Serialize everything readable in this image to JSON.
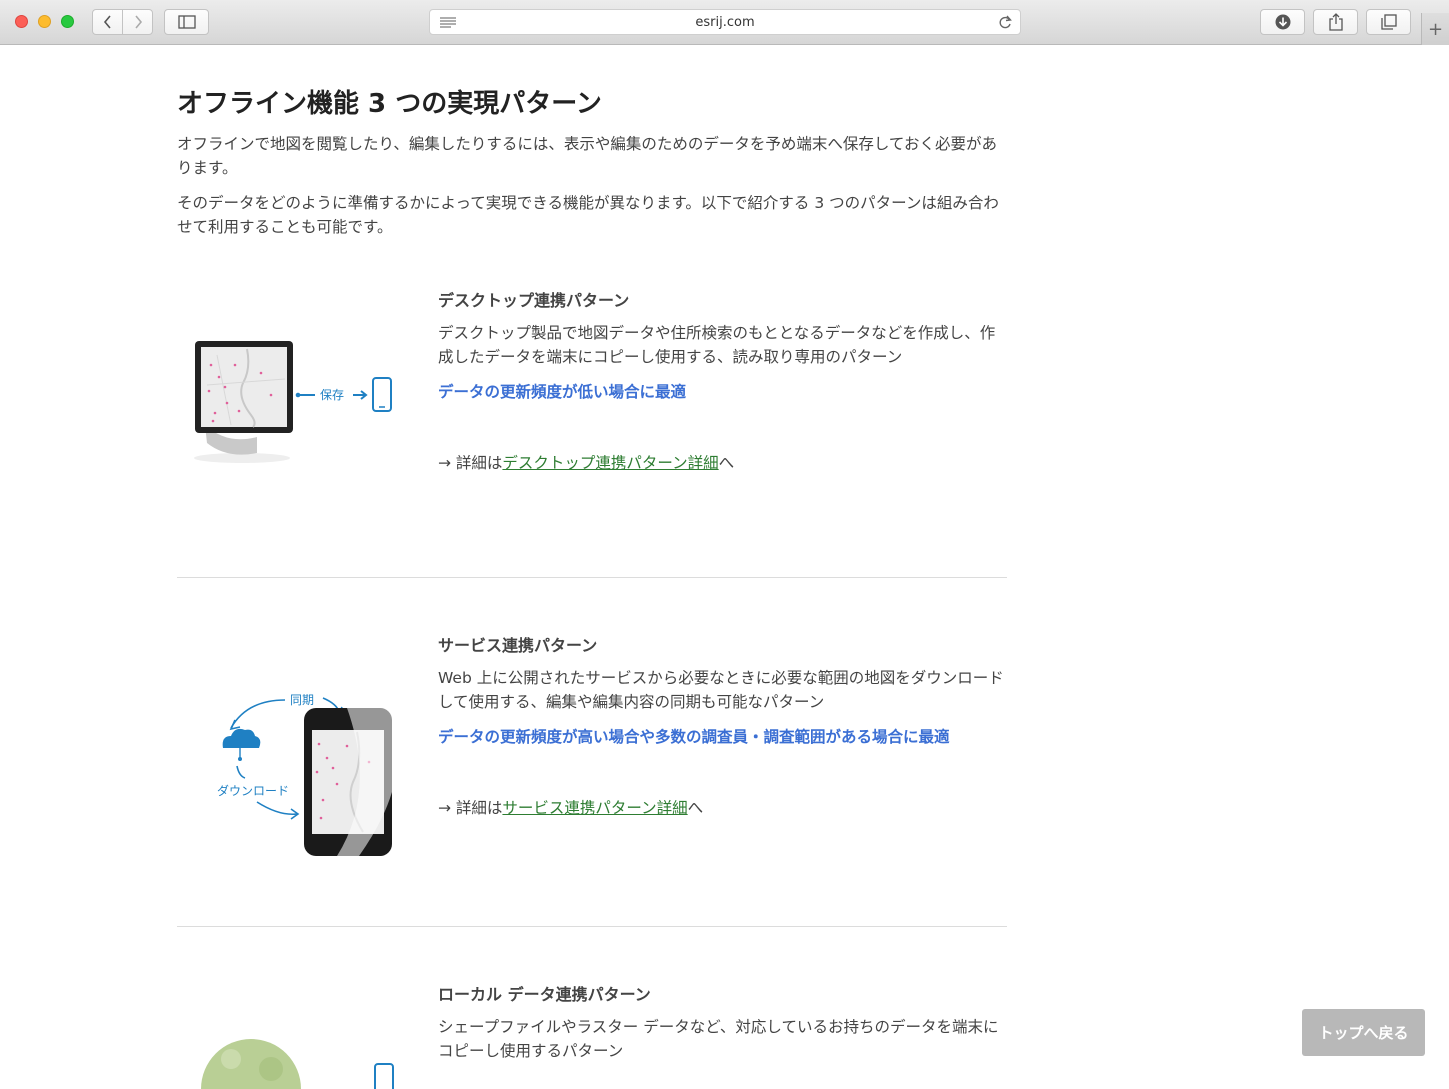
{
  "browser": {
    "url": "esrij.com",
    "new_tab_glyph": "+"
  },
  "page": {
    "title": "オフライン機能 3 つの実現パターン",
    "intro": [
      "オフラインで地図を閲覧したり、編集したりするには、表示や編集のためのデータを予め端末へ保存しておく必要があります。",
      "そのデータをどのように準備するかによって実現できる機能が異なります。以下で紹介する 3 つのパターンは組み合わせて利用することも可能です。"
    ],
    "sections": [
      {
        "title": "デスクトップ連携パターン",
        "desc": "デスクトップ製品で地図データや住所検索のもととなるデータなどを作成し、作成したデータを端末にコピーし使用する、読み取り専用のパターン",
        "best": "データの更新頻度が低い場合に最適",
        "more_prefix": "→ 詳細は",
        "more_link": "デスクトップ連携パターン詳細",
        "more_suffix": "へ",
        "illus_label": "保存"
      },
      {
        "title": "サービス連携パターン",
        "desc": "Web 上に公開されたサービスから必要なときに必要な範囲の地図をダウンロードして使用する、編集や編集内容の同期も可能なパターン",
        "best": "データの更新頻度が高い場合や多数の調査員・調査範囲がある場合に最適",
        "more_prefix": "→ 詳細は",
        "more_link": "サービス連携パターン詳細",
        "more_suffix": "へ",
        "illus_label_sync": "同期",
        "illus_label_download": "ダウンロード"
      },
      {
        "title": "ローカル データ連携パターン",
        "desc": "シェープファイルやラスター データなど、対応しているお持ちのデータを端末にコピーし使用するパターン"
      }
    ],
    "back_to_top": "トップへ戻る"
  },
  "colors": {
    "accent_blue": "#3b6fd4",
    "link_green": "#2e7d32",
    "illus_blue": "#1f80c3"
  }
}
